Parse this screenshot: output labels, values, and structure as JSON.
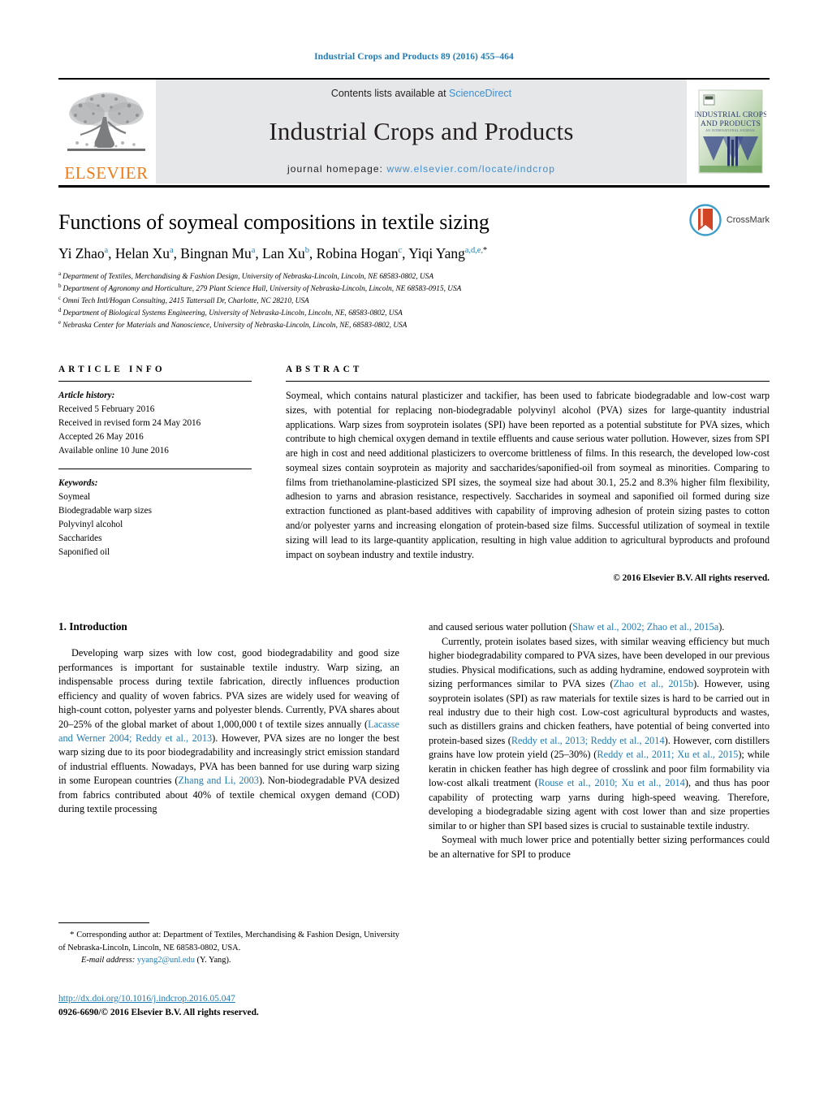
{
  "running_head": "Industrial Crops and Products 89 (2016) 455–464",
  "journal_header": {
    "publisher_name": "ELSEVIER",
    "contents_prefix": "Contents lists available at ",
    "contents_link": "ScienceDirect",
    "journal_name": "Industrial Crops and Products",
    "homepage_prefix": "journal homepage: ",
    "homepage_url": "www.elsevier.com/locate/indcrop",
    "cover_title_line1": "INDUSTRIAL CROPS",
    "cover_title_line2": "AND PRODUCTS",
    "link_color": "#3b8fd4",
    "band_color": "#e6e7e8",
    "elsevier_orange": "#ef7c1a"
  },
  "article": {
    "title": "Functions of soymeal compositions in textile sizing",
    "authors": [
      {
        "name": "Yi Zhao",
        "marks": "a"
      },
      {
        "name": "Helan Xu",
        "marks": "a"
      },
      {
        "name": "Bingnan Mu",
        "marks": "a"
      },
      {
        "name": "Lan Xu",
        "marks": "b"
      },
      {
        "name": "Robina Hogan",
        "marks": "c"
      },
      {
        "name": "Yiqi Yang",
        "marks": "a,d,e,",
        "star": "*"
      }
    ],
    "affiliations": [
      {
        "mark": "a",
        "text": "Department of Textiles, Merchandising & Fashion Design, University of Nebraska-Lincoln, Lincoln, NE 68583-0802, USA"
      },
      {
        "mark": "b",
        "text": "Department of Agronomy and Horticulture, 279 Plant Science Hall, University of Nebraska-Lincoln, Lincoln, NE 68583-0915, USA"
      },
      {
        "mark": "c",
        "text": "Omni Tech Intl/Hogan Consulting, 2415 Tattersall Dr, Charlotte, NC 28210, USA"
      },
      {
        "mark": "d",
        "text": "Department of Biological Systems Engineering, University of Nebraska-Lincoln, Lincoln, NE, 68583-0802, USA"
      },
      {
        "mark": "e",
        "text": "Nebraska Center for Materials and Nanoscience, University of Nebraska-Lincoln, Lincoln, NE, 68583-0802, USA"
      }
    ],
    "crossmark_label": "CrossMark"
  },
  "article_info": {
    "heading": "ARTICLE INFO",
    "history_label": "Article history:",
    "history": [
      "Received 5 February 2016",
      "Received in revised form 24 May 2016",
      "Accepted 26 May 2016",
      "Available online 10 June 2016"
    ],
    "keywords_label": "Keywords:",
    "keywords": [
      "Soymeal",
      "Biodegradable warp sizes",
      "Polyvinyl alcohol",
      "Saccharides",
      "Saponified oil"
    ]
  },
  "abstract": {
    "heading": "ABSTRACT",
    "text": "Soymeal, which contains natural plasticizer and tackifier, has been used to fabricate biodegradable and low-cost warp sizes, with potential for replacing non-biodegradable polyvinyl alcohol (PVA) sizes for large-quantity industrial applications. Warp sizes from soyprotein isolates (SPI) have been reported as a potential substitute for PVA sizes, which contribute to high chemical oxygen demand in textile effluents and cause serious water pollution. However, sizes from SPI are high in cost and need additional plasticizers to overcome brittleness of films. In this research, the developed low-cost soymeal sizes contain soyprotein as majority and saccharides/saponified-oil from soymeal as minorities. Comparing to films from triethanolamine-plasticized SPI sizes, the soymeal size had about 30.1, 25.2 and 8.3% higher film flexibility, adhesion to yarns and abrasion resistance, respectively. Saccharides in soymeal and saponified oil formed during size extraction functioned as plant-based additives with capability of improving adhesion of protein sizing pastes to cotton and/or polyester yarns and increasing elongation of protein-based size films. Successful utilization of soymeal in textile sizing will lead to its large-quantity application, resulting in high value addition to agricultural byproducts and profound impact on soybean industry and textile industry.",
    "copyright": "© 2016 Elsevier B.V. All rights reserved."
  },
  "body": {
    "section_title": "1.  Introduction",
    "left_paragraphs": [
      "Developing warp sizes with low cost, good biodegradability and good size performances is important for sustainable textile industry. Warp sizing, an indispensable process during textile fabrication, directly influences production efficiency and quality of woven fabrics. PVA sizes are widely used for weaving of high-count cotton, polyester yarns and polyester blends. Currently, PVA shares about 20–25% of the global market of about 1,000,000 t of textile sizes annually (@@Lacasse and Werner 2004; Reddy et al., 2013@@). However, PVA sizes are no longer the best warp sizing due to its poor biodegradability and increasingly strict emission standard of industrial effluents. Nowadays, PVA has been banned for use during warp sizing in some European countries (@@Zhang and Li, 2003@@). Non-biodegradable PVA desized from fabrics contributed about 40% of textile chemical oxygen demand (COD) during textile processing"
    ],
    "right_paragraphs": [
      "and caused serious water pollution (@@Shaw et al., 2002; Zhao et al., 2015a@@).",
      "Currently, protein isolates based sizes, with similar weaving efficiency but much higher biodegradability compared to PVA sizes, have been developed in our previous studies. Physical modifications, such as adding hydramine, endowed soyprotein with sizing performances similar to PVA sizes (@@Zhao et al., 2015b@@). However, using soyprotein isolates (SPI) as raw materials for textile sizes is hard to be carried out in real industry due to their high cost. Low-cost agricultural byproducts and wastes, such as distillers grains and chicken feathers, have potential of being converted into protein-based sizes (@@Reddy et al., 2013; Reddy et al., 2014@@). However, corn distillers grains have low protein yield (25–30%) (@@Reddy et al., 2011; Xu et al., 2015@@); while keratin in chicken feather has high degree of crosslink and poor film formability via low-cost alkali treatment (@@Rouse et al., 2010; Xu et al., 2014@@), and thus has poor capability of protecting warp yarns during high-speed weaving. Therefore, developing a biodegradable sizing agent with cost lower than and size properties similar to or higher than SPI based sizes is crucial to sustainable textile industry.",
      "Soymeal with much lower price and potentially better sizing performances could be an alternative for SPI to produce"
    ],
    "right_first_paragraph_noindent": true
  },
  "footnote": {
    "star": "*",
    "text": "Corresponding author at: Department of Textiles, Merchandising & Fashion Design, University of Nebraska-Lincoln, Lincoln, NE 68583-0802, USA.",
    "email_label": "E-mail address:",
    "email": "yyang2@unl.edu",
    "email_suffix": "(Y. Yang)."
  },
  "doi": {
    "url": "http://dx.doi.org/10.1016/j.indcrop.2016.05.047",
    "issn_line": "0926-6690/© 2016 Elsevier B.V. All rights reserved."
  }
}
